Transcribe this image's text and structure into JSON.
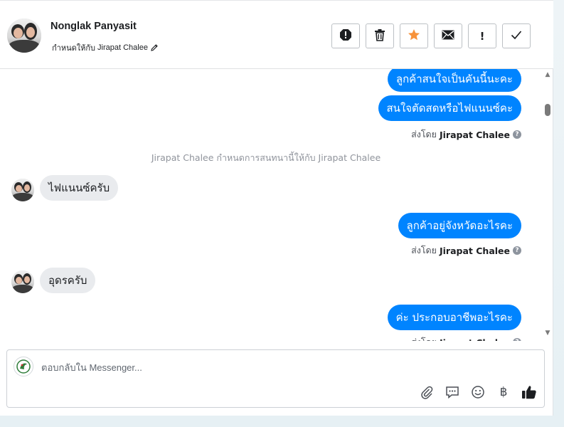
{
  "header": {
    "contact_name": "Nonglak Panyasit",
    "assign_prefix": "กำหนดให้กับ",
    "assigned_to": "Jirapat Chalee",
    "actions": [
      {
        "icon": "alert-circle-icon",
        "glyph": "!"
      },
      {
        "icon": "trash-icon",
        "glyph": ""
      },
      {
        "icon": "star-icon",
        "glyph": "★"
      },
      {
        "icon": "envelope-icon",
        "glyph": "✉"
      },
      {
        "icon": "exclamation-icon",
        "glyph": "!"
      },
      {
        "icon": "check-icon",
        "glyph": "✓"
      }
    ]
  },
  "messages": {
    "out_1": "ลูกค้าสนใจเป็นคันนี้นะคะ",
    "out_2": "สนใจตัดสดหรือไฟแนนซ์คะ",
    "sent_by_prefix": "ส่งโดย",
    "sent_by_name": "Jirapat Chalee",
    "system_note": "Jirapat Chalee กำหนดการสนทนานี้ให้กับ Jirapat Chalee",
    "in_1": "ไฟแนนซ์ครับ",
    "out_3": "ลูกค้าอยู่จังหวัดอะไรคะ",
    "in_2": "อุดรครับ",
    "out_4": "ค่ะ ประกอบอาชีพอะไรคะ"
  },
  "composer": {
    "placeholder": "ตอบกลับใน Messenger...",
    "tools": [
      "paperclip-icon",
      "chat-bubble-icon",
      "emoji-icon",
      "baht-icon",
      "thumbs-up-icon"
    ],
    "baht_glyph": "฿"
  },
  "colors": {
    "accent": "#0084ff",
    "star": "#f7923a"
  }
}
